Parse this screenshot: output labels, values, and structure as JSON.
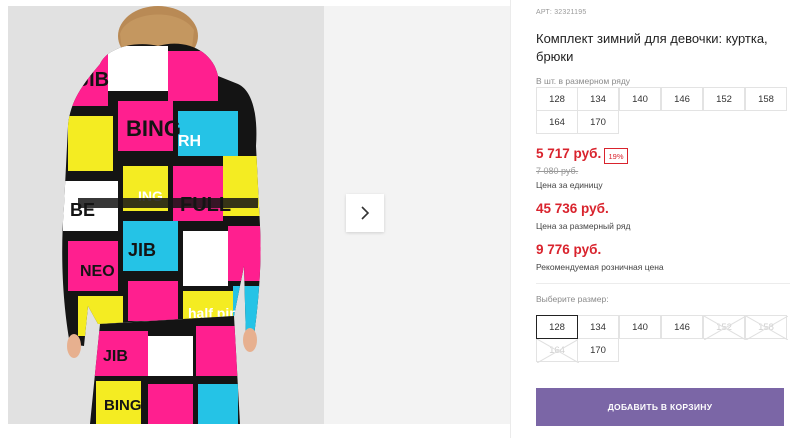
{
  "product": {
    "article": "АРТ: 32321195",
    "title": "Комплект зимний для девочки: куртка, брюки"
  },
  "size_row": {
    "label": "В шт. в размерном ряду",
    "sizes": [
      "128",
      "134",
      "140",
      "146",
      "152",
      "158",
      "164",
      "170"
    ]
  },
  "pricing": {
    "unit_price": "5 717 руб.",
    "discount": "19%",
    "old_price": "7 080 руб.",
    "unit_caption": "Цена за единицу",
    "row_price": "45 736 руб.",
    "row_caption": "Цена за размерный ряд",
    "retail_price": "9 776 руб.",
    "retail_caption": "Рекомендуемая розничная цена"
  },
  "size_select": {
    "label": "Выберите размер:",
    "selected": "128",
    "options": [
      {
        "label": "128",
        "available": true
      },
      {
        "label": "134",
        "available": true
      },
      {
        "label": "140",
        "available": true
      },
      {
        "label": "146",
        "available": true
      },
      {
        "label": "152",
        "available": false
      },
      {
        "label": "158",
        "available": false
      },
      {
        "label": "164",
        "available": false
      },
      {
        "label": "170",
        "available": true
      }
    ]
  },
  "cart": {
    "button_label": "ДОБАВИТЬ В КОРЗИНУ"
  },
  "gallery": {
    "next_icon": "chevron-right-icon"
  },
  "colors": {
    "price_red": "#d9232d",
    "button_purple": "#7b66a6",
    "jacket_pink": "#ff1f8f",
    "jacket_yellow": "#f4ec22",
    "jacket_cyan": "#25c3e6"
  }
}
